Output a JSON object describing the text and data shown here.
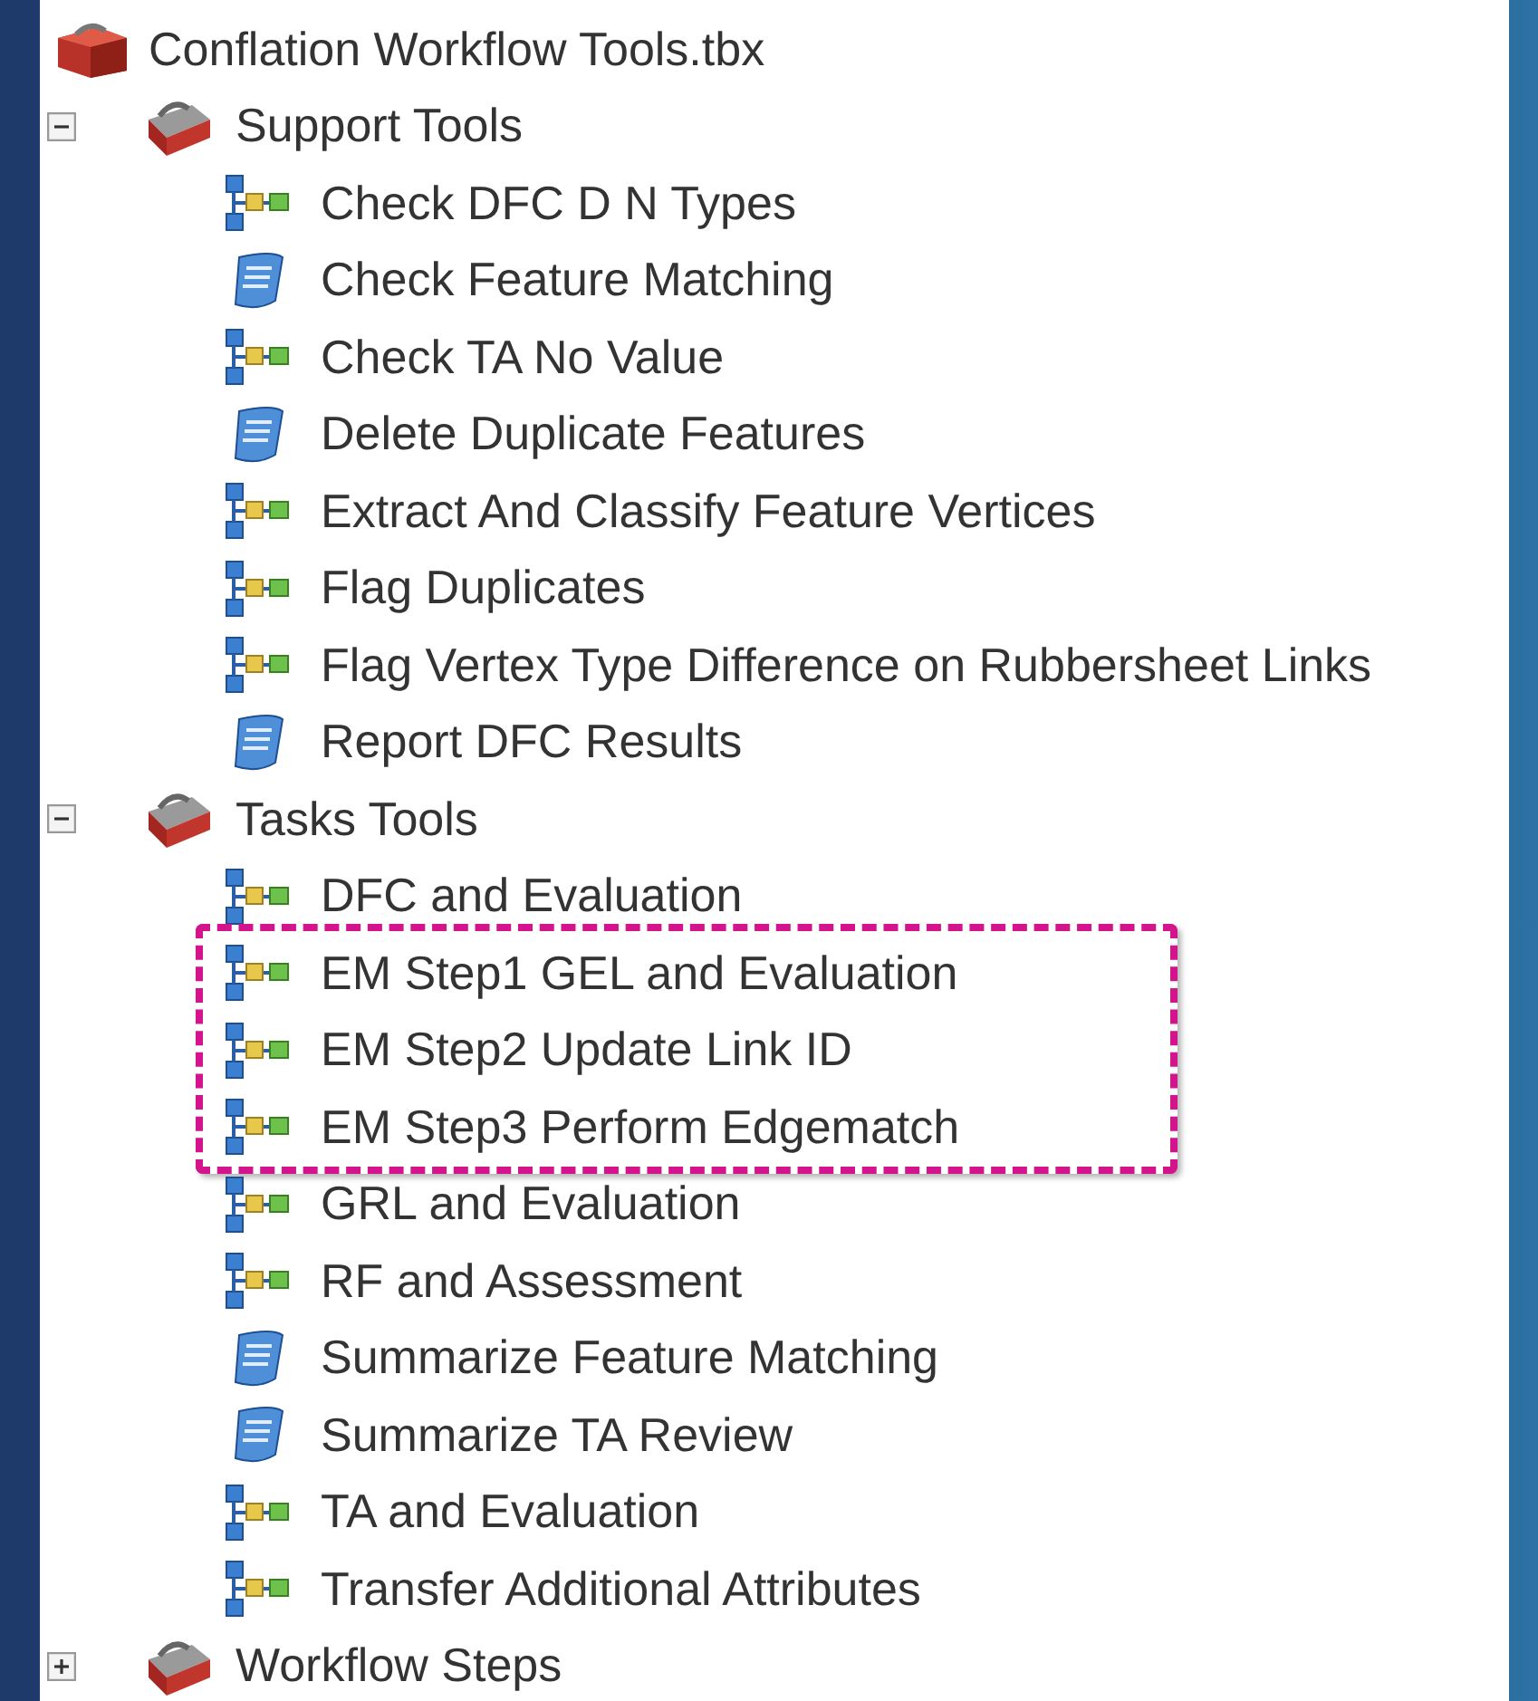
{
  "toolbox": {
    "name": "Conflation Workflow Tools.tbx",
    "toolsets": [
      {
        "name": "Support Tools",
        "expanded": true,
        "tools": [
          {
            "name": "Check DFC D N Types",
            "kind": "model",
            "highlighted": false
          },
          {
            "name": "Check Feature Matching",
            "kind": "script",
            "highlighted": false
          },
          {
            "name": "Check TA No Value",
            "kind": "model",
            "highlighted": false
          },
          {
            "name": "Delete Duplicate Features",
            "kind": "script",
            "highlighted": false
          },
          {
            "name": "Extract And Classify Feature Vertices",
            "kind": "model",
            "highlighted": false
          },
          {
            "name": "Flag Duplicates",
            "kind": "model",
            "highlighted": false
          },
          {
            "name": "Flag Vertex Type Difference on Rubbersheet Links",
            "kind": "model",
            "highlighted": false
          },
          {
            "name": "Report DFC Results",
            "kind": "script",
            "highlighted": false
          }
        ]
      },
      {
        "name": "Tasks Tools",
        "expanded": true,
        "tools": [
          {
            "name": "DFC and Evaluation",
            "kind": "model",
            "highlighted": false
          },
          {
            "name": "EM Step1 GEL and Evaluation",
            "kind": "model",
            "highlighted": true
          },
          {
            "name": "EM Step2 Update Link ID",
            "kind": "model",
            "highlighted": true
          },
          {
            "name": "EM Step3 Perform Edgematch",
            "kind": "model",
            "highlighted": true
          },
          {
            "name": "GRL and Evaluation",
            "kind": "model",
            "highlighted": false
          },
          {
            "name": "RF and Assessment",
            "kind": "model",
            "highlighted": false
          },
          {
            "name": "Summarize Feature Matching",
            "kind": "script",
            "highlighted": false
          },
          {
            "name": "Summarize TA Review",
            "kind": "script",
            "highlighted": false
          },
          {
            "name": "TA and Evaluation",
            "kind": "model",
            "highlighted": false
          },
          {
            "name": "Transfer Additional Attributes",
            "kind": "model",
            "highlighted": false
          }
        ]
      },
      {
        "name": "Workflow Steps",
        "expanded": false
      }
    ]
  }
}
